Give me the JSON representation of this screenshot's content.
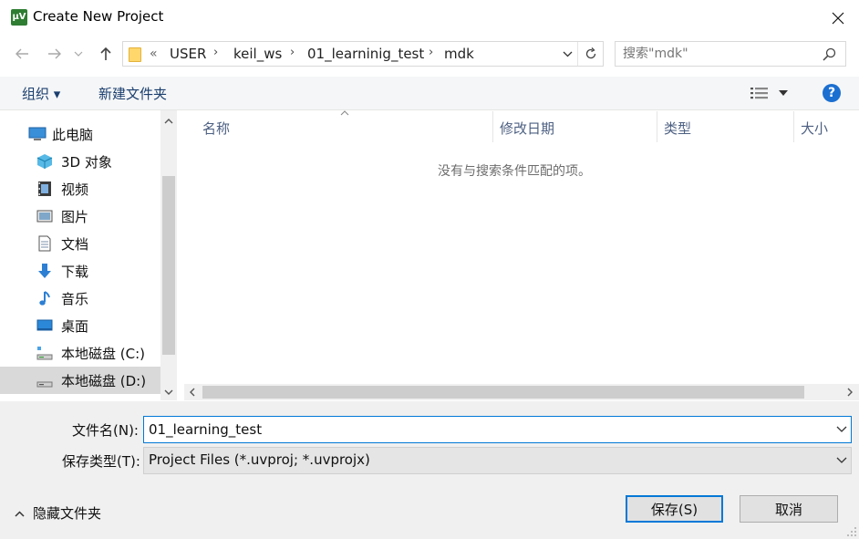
{
  "window": {
    "title": "Create New Project",
    "app_icon_text": "µV"
  },
  "address": {
    "prefix": "«",
    "crumbs": [
      "USER",
      "keil_ws",
      "01_learninig_test",
      "mdk"
    ]
  },
  "search": {
    "placeholder": "搜索\"mdk\""
  },
  "toolbar": {
    "organize_label": "组织 ▾",
    "new_folder_label": "新建文件夹"
  },
  "nav": {
    "items": [
      {
        "label": "此电脑",
        "icon": "computer-icon"
      },
      {
        "label": "3D 对象",
        "icon": "3d-objects-icon"
      },
      {
        "label": "视频",
        "icon": "video-icon"
      },
      {
        "label": "图片",
        "icon": "pictures-icon"
      },
      {
        "label": "文档",
        "icon": "documents-icon"
      },
      {
        "label": "下载",
        "icon": "download-icon"
      },
      {
        "label": "音乐",
        "icon": "music-icon"
      },
      {
        "label": "桌面",
        "icon": "desktop-icon"
      },
      {
        "label": "本地磁盘 (C:)",
        "icon": "drive-c-icon"
      },
      {
        "label": "本地磁盘 (D:)",
        "icon": "drive-d-icon",
        "selected": true
      }
    ]
  },
  "filelist": {
    "columns": [
      "名称",
      "修改日期",
      "类型",
      "大小"
    ],
    "empty_message": "没有与搜索条件匹配的项。"
  },
  "form": {
    "filename_label": "文件名(N):",
    "filename_value": "01_learning_test",
    "filetype_label": "保存类型(T):",
    "filetype_value": "Project Files (*.uvproj; *.uvprojx)"
  },
  "footer": {
    "hide_folders_label": "隐藏文件夹",
    "save_label": "保存(S)",
    "cancel_label": "取消"
  },
  "colors": {
    "accent": "#0078d7",
    "help": "#1b6fd0",
    "link": "#1a3e6e"
  }
}
